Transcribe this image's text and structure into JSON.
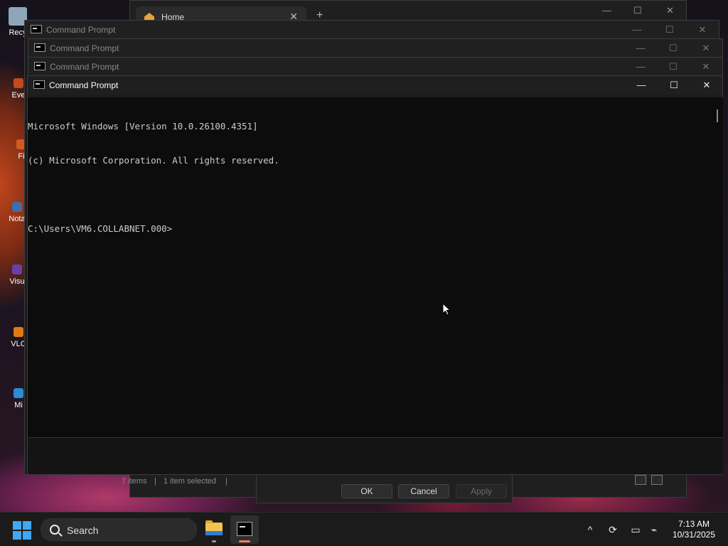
{
  "desktop": {
    "icons": [
      {
        "name": "recycle-bin",
        "label": "Recy",
        "color": "#8fa6b8"
      },
      {
        "name": "everything",
        "label": "Eve",
        "color": "#c24a1c"
      },
      {
        "name": "firefox",
        "label": "Fi",
        "color": "#d2591e"
      },
      {
        "name": "notepad",
        "label": "Nota",
        "color": "#3e6fa8"
      },
      {
        "name": "visual-studio",
        "label": "Visu",
        "color": "#6b3fa8"
      },
      {
        "name": "vlc",
        "label": "VLC",
        "color": "#e07a12"
      },
      {
        "name": "microsoft-edge",
        "label": "Mi",
        "color": "#2a8cd4"
      }
    ]
  },
  "explorer": {
    "tab_label": "Home",
    "tab_close": "✕",
    "new_tab": "+",
    "minimize": "—",
    "maximize": "☐",
    "close": "✕",
    "status_items": "7 items",
    "status_selected": "1 item selected",
    "status_sep": "|"
  },
  "dialog": {
    "ok_label": "OK",
    "cancel_label": "Cancel",
    "apply_label": "Apply"
  },
  "cmd": {
    "title": "Command Prompt",
    "minimize": "—",
    "maximize": "☐",
    "close": "✕",
    "lines": [
      "Microsoft Windows [Version 10.0.26100.4351]",
      "(c) Microsoft Corporation. All rights reserved.",
      "",
      "C:\\Users\\VM6.COLLABNET.000>"
    ]
  },
  "taskbar": {
    "search_label": "Search",
    "tray": {
      "chevron": "^",
      "sync": "⟳",
      "display": "▭",
      "network": "⌁"
    },
    "time": "7:13 AM",
    "date": "10/31/2025"
  },
  "colors": {
    "accent_blue": "#3fa8f0",
    "console_bg": "#0c0c0c",
    "console_text": "#cccccc",
    "indicator_cmd": "#e8825a"
  }
}
